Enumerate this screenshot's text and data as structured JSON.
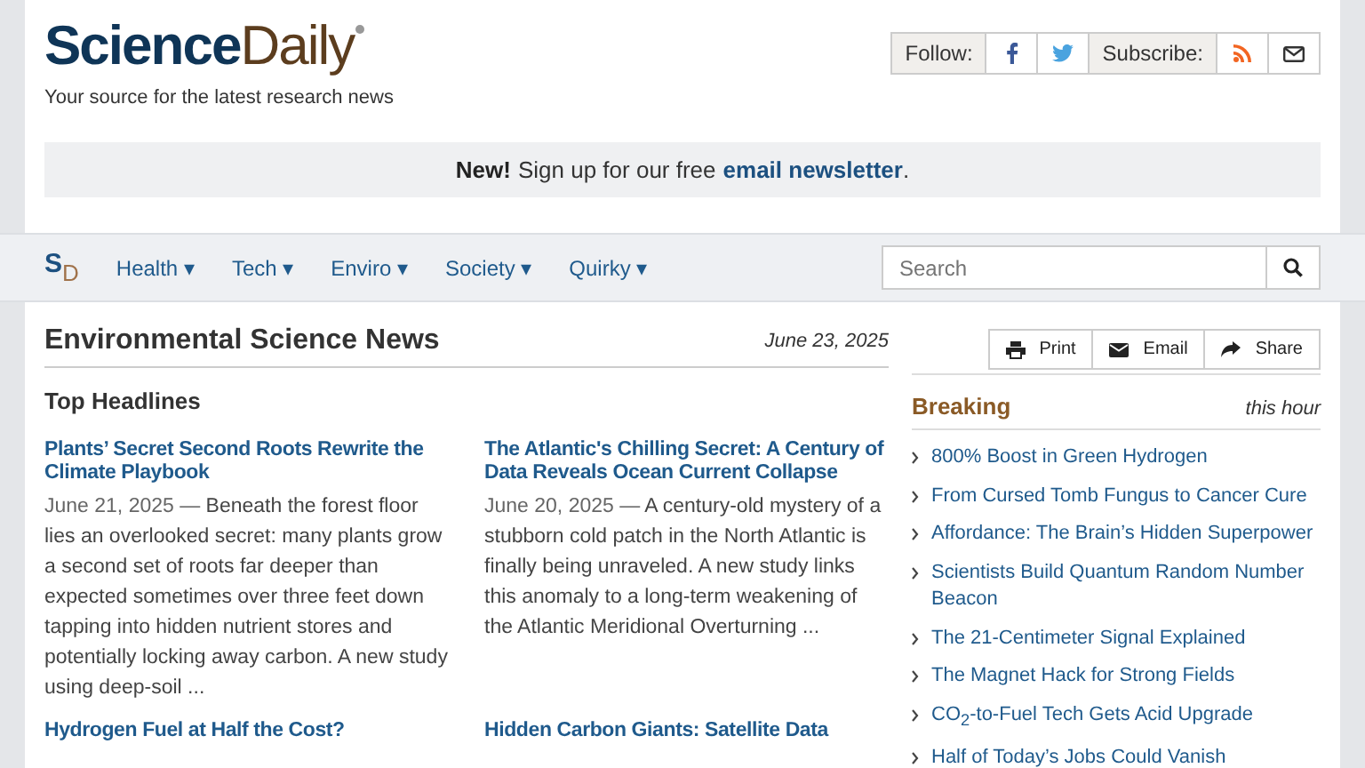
{
  "logo": {
    "part_1": "Science",
    "part_2": "Daily"
  },
  "tagline": "Your source for the latest research news",
  "social": {
    "follow_label": "Follow:",
    "subscribe_label": "Subscribe:"
  },
  "banner": {
    "lead": "New!",
    "text": "Sign up for our free",
    "link": "email newsletter",
    "end": "."
  },
  "nav": {
    "logo_s": "S",
    "logo_d": "D",
    "items": [
      "Health",
      "Tech",
      "Enviro",
      "Society",
      "Quirky"
    ],
    "caret": "▾"
  },
  "search": {
    "placeholder": "Search"
  },
  "section": {
    "title": "Environmental Science News",
    "date": "June 23, 2025"
  },
  "tools": [
    "Print",
    "Email",
    "Share"
  ],
  "top_headlines": {
    "title": "Top Headlines",
    "stories": [
      {
        "title": "Plants’ Secret Second Roots Rewrite the Climate Playbook",
        "date": "June 21, 2025",
        "separator": "—",
        "summary": "Beneath the forest floor lies an overlooked secret: many plants grow a second set of roots far deeper than expected sometimes over three feet down tapping into hidden nutrient stores and potentially locking away carbon. A new study using deep-soil ..."
      },
      {
        "title": "The Atlantic's Chilling Secret: A Century of Data Reveals Ocean Current Collapse",
        "date": "June 20, 2025",
        "separator": "—",
        "summary": "A century-old mystery of a stubborn cold patch in the North Atlantic is finally being unraveled. A new study links this anomaly to a long-term weakening of the Atlantic Meridional Overturning ..."
      },
      {
        "title": "Hydrogen Fuel at Half the Cost?"
      },
      {
        "title": "Hidden Carbon Giants: Satellite Data"
      }
    ]
  },
  "breaking": {
    "title": "Breaking",
    "when": "this hour",
    "items": [
      "800% Boost in Green Hydrogen",
      "From Cursed Tomb Fungus to Cancer Cure",
      "Affordance: The Brain’s Hidden Superpower",
      "Scientists Build Quantum Random Number Beacon",
      "The 21-Centimeter Signal Explained",
      "The Magnet Hack for Strong Fields",
      "CO$_{2}$-to-Fuel Tech Gets Acid Upgrade",
      "Half of Today’s Jobs Could Vanish"
    ]
  }
}
